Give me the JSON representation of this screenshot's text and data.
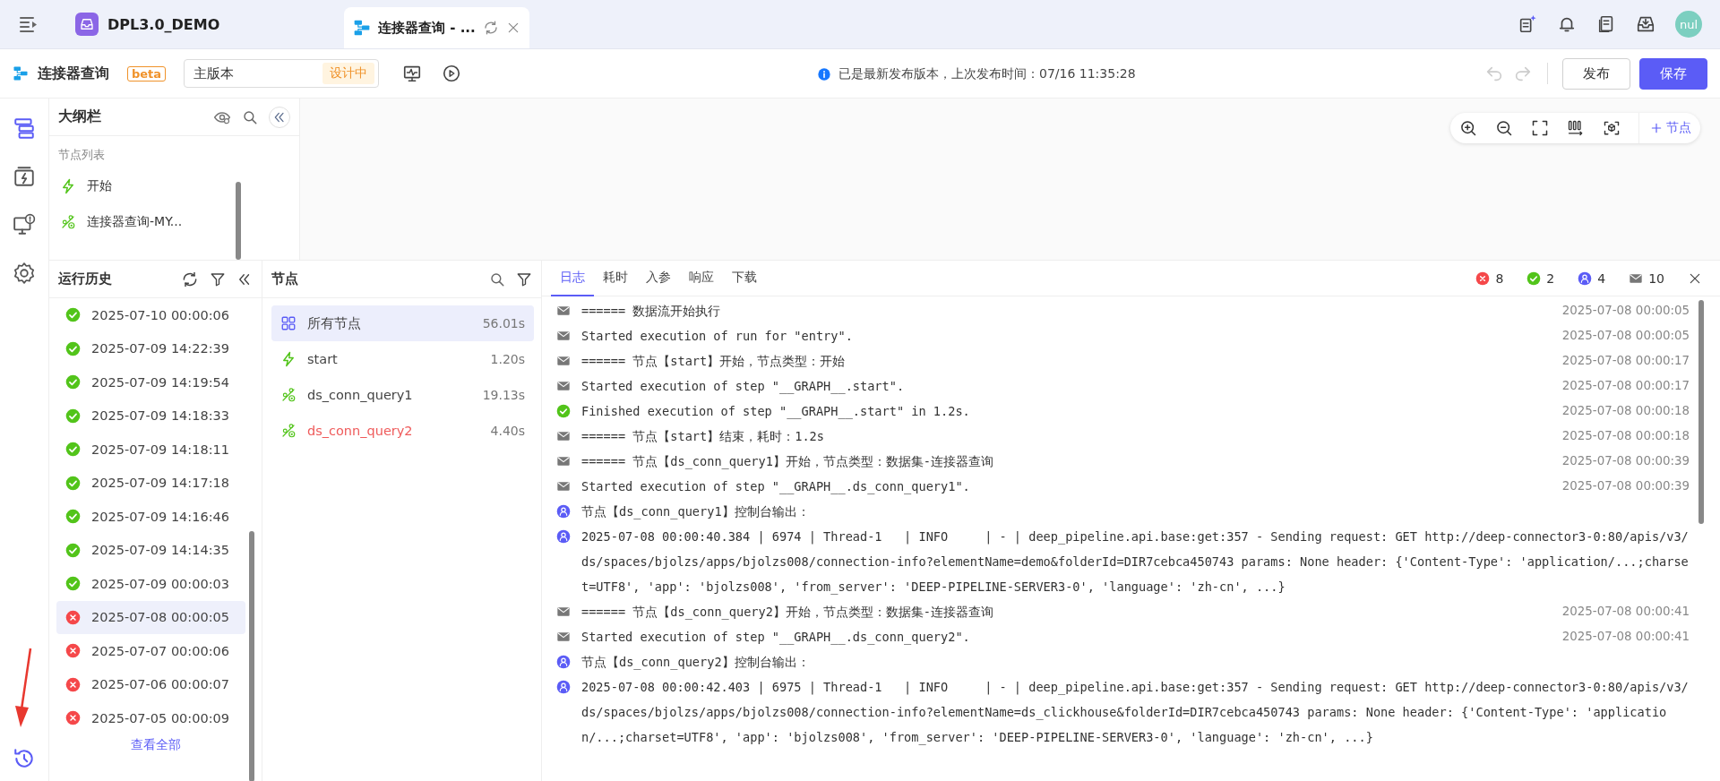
{
  "top_bar": {
    "app_title": "DPL3.0_DEMO",
    "tabs": [
      {
        "label": "连接器查询 - ...",
        "selected": true
      }
    ],
    "avatar": "nul"
  },
  "toolbar": {
    "title": "连接器查询",
    "badge": "beta",
    "version": {
      "value": "主版本",
      "tag": "设计中"
    },
    "info": "已是最新发布版本，上次发布时间：07/16 11:35:28",
    "history": [
      {
        "kind": "undo",
        "disabled": true
      },
      {
        "kind": "redo",
        "disabled": true
      }
    ],
    "buttons": [
      {
        "label": "发布",
        "kind": "default"
      },
      {
        "label": "保存",
        "kind": "primary"
      }
    ]
  },
  "side_rail": {
    "items": [
      {
        "kind": "outline",
        "selected": true
      },
      {
        "kind": "trigger",
        "selected": false
      },
      {
        "kind": "monitor",
        "selected": false
      },
      {
        "kind": "settings",
        "selected": false
      }
    ],
    "bottom": {
      "kind": "history",
      "selected": true
    }
  },
  "outline": {
    "title": "大纲栏",
    "section": "节点列表",
    "items": [
      {
        "kind": "start",
        "label": "开始"
      },
      {
        "kind": "connector",
        "label": "连接器查询-MY..."
      }
    ]
  },
  "canvas_toolbar": {
    "add_label": "节点"
  },
  "run_history": {
    "title": "运行历史",
    "items": [
      {
        "time": "2025-07-10 00:00:06",
        "kind": "success",
        "selected": false
      },
      {
        "time": "2025-07-09 14:22:39",
        "kind": "success",
        "selected": false
      },
      {
        "time": "2025-07-09 14:19:54",
        "kind": "success",
        "selected": false
      },
      {
        "time": "2025-07-09 14:18:33",
        "kind": "success",
        "selected": false
      },
      {
        "time": "2025-07-09 14:18:11",
        "kind": "success",
        "selected": false
      },
      {
        "time": "2025-07-09 14:17:18",
        "kind": "success",
        "selected": false
      },
      {
        "time": "2025-07-09 14:16:46",
        "kind": "success",
        "selected": false
      },
      {
        "time": "2025-07-09 14:14:35",
        "kind": "success",
        "selected": false
      },
      {
        "time": "2025-07-09 00:00:03",
        "kind": "success",
        "selected": false
      },
      {
        "time": "2025-07-08 00:00:05",
        "kind": "error",
        "selected": true
      },
      {
        "time": "2025-07-07 00:00:06",
        "kind": "error",
        "selected": false
      },
      {
        "time": "2025-07-06 00:00:07",
        "kind": "error",
        "selected": false
      },
      {
        "time": "2025-07-05 00:00:09",
        "kind": "error",
        "selected": false
      }
    ],
    "view_all": "查看全部"
  },
  "nodes": {
    "title": "节点",
    "items": [
      {
        "kind": "all",
        "name": "所有节点",
        "duration": "56.01s",
        "selected": true,
        "failed": false
      },
      {
        "kind": "start",
        "name": "start",
        "duration": "1.20s",
        "selected": false,
        "failed": false
      },
      {
        "kind": "connector",
        "name": "ds_conn_query1",
        "duration": "19.13s",
        "selected": false,
        "failed": false
      },
      {
        "kind": "connector",
        "name": "ds_conn_query2",
        "duration": "4.40s",
        "selected": false,
        "failed": true
      }
    ]
  },
  "log": {
    "tabs": [
      {
        "label": "日志",
        "selected": true
      },
      {
        "label": "耗时",
        "selected": false
      },
      {
        "label": "入参",
        "selected": false
      },
      {
        "label": "响应",
        "selected": false
      },
      {
        "label": "下载",
        "selected": false
      }
    ],
    "counts": [
      {
        "kind": "error",
        "value": "8"
      },
      {
        "kind": "success",
        "value": "2"
      },
      {
        "kind": "user",
        "value": "4"
      },
      {
        "kind": "mail",
        "value": "10"
      }
    ],
    "entries": [
      {
        "kind": "mail",
        "text": "====== 数据流开始执行",
        "time": "2025-07-08 00:00:05"
      },
      {
        "kind": "mail",
        "text": "Started execution of run for \"entry\".",
        "time": "2025-07-08 00:00:05"
      },
      {
        "kind": "mail",
        "text": "====== 节点【start】开始，节点类型：开始",
        "time": "2025-07-08 00:00:17"
      },
      {
        "kind": "mail",
        "text": "Started execution of step \"__GRAPH__.start\".",
        "time": "2025-07-08 00:00:17"
      },
      {
        "kind": "success",
        "text": "Finished execution of step \"__GRAPH__.start\" in 1.2s.",
        "time": "2025-07-08 00:00:18"
      },
      {
        "kind": "mail",
        "text": "====== 节点【start】结束，耗时：1.2s",
        "time": "2025-07-08 00:00:18"
      },
      {
        "kind": "mail",
        "text": "====== 节点【ds_conn_query1】开始，节点类型：数据集-连接器查询",
        "time": "2025-07-08 00:00:39"
      },
      {
        "kind": "mail",
        "text": "Started execution of step \"__GRAPH__.ds_conn_query1\".",
        "time": "2025-07-08 00:00:39"
      },
      {
        "kind": "user",
        "text": "节点【ds_conn_query1】控制台输出："
      },
      {
        "kind": "user",
        "text": "2025-07-08 00:00:40.384 | 6974 | Thread-1   | INFO     | - | deep_pipeline.api.base:get:357 - Sending request: GET http://deep-connector3-0:80/apis/v3/ds/spaces/bjolzs/apps/bjolzs008/connection-info?elementName=demo&folderId=DIR7cebca450743 params: None header: {'Content-Type': 'application/...;charset=UTF8', 'app': 'bjolzs008', 'from_server': 'DEEP-PIPELINE-SERVER3-0', 'language': 'zh-cn', ...}"
      },
      {
        "kind": "mail",
        "text": "====== 节点【ds_conn_query2】开始，节点类型：数据集-连接器查询",
        "time": "2025-07-08 00:00:41"
      },
      {
        "kind": "mail",
        "text": "Started execution of step \"__GRAPH__.ds_conn_query2\".",
        "time": "2025-07-08 00:00:41"
      },
      {
        "kind": "user",
        "text": "节点【ds_conn_query2】控制台输出："
      },
      {
        "kind": "user",
        "text": "2025-07-08 00:00:42.403 | 6975 | Thread-1   | INFO     | - | deep_pipeline.api.base:get:357 - Sending request: GET http://deep-connector3-0:80/apis/v3/ds/spaces/bjolzs/apps/bjolzs008/connection-info?elementName=ds_clickhouse&folderId=DIR7cebca450743 params: None header: {'Content-Type': 'application/...;charset=UTF8', 'app': 'bjolzs008', 'from_server': 'DEEP-PIPELINE-SERVER3-0', 'language': 'zh-cn', ...}"
      }
    ]
  }
}
